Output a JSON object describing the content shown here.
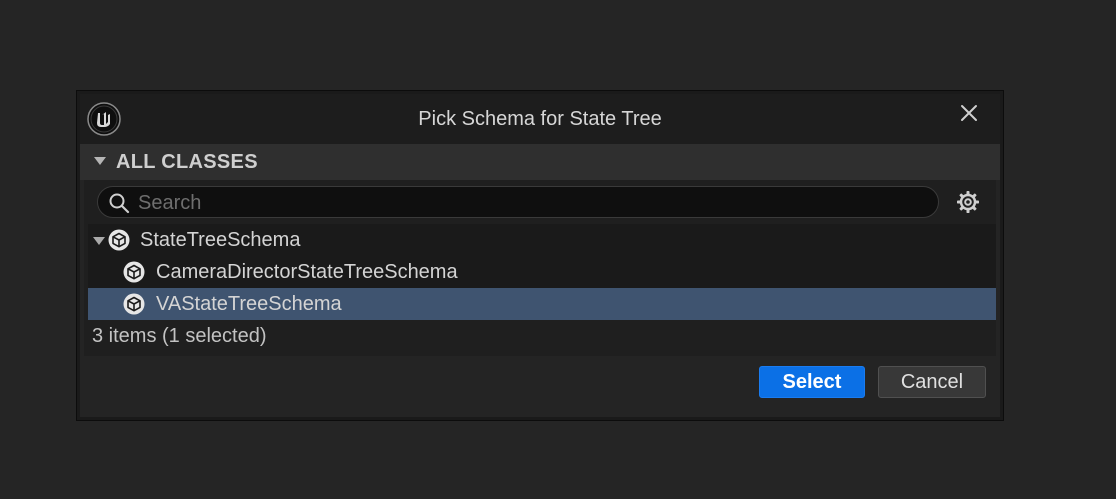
{
  "dialog": {
    "title": "Pick Schema for State Tree",
    "logo_icon": "unreal-engine-logo",
    "close_icon": "close-icon"
  },
  "section": {
    "label": "ALL CLASSES"
  },
  "search": {
    "placeholder": "Search",
    "value": ""
  },
  "settings_icon": "gear-icon",
  "tree": {
    "items": [
      {
        "label": "StateTreeSchema",
        "icon": "class-cube-icon",
        "level": 0,
        "expanded": true,
        "selected": false
      },
      {
        "label": "CameraDirectorStateTreeSchema",
        "icon": "class-cube-icon",
        "level": 1,
        "selected": false
      },
      {
        "label": "VAStateTreeSchema",
        "icon": "class-cube-icon",
        "level": 1,
        "selected": true
      }
    ]
  },
  "status": "3 items (1 selected)",
  "buttons": {
    "select": "Select",
    "cancel": "Cancel"
  },
  "colors": {
    "accent": "#0b70e6",
    "selection": "#3f5470",
    "background": "#252525"
  }
}
